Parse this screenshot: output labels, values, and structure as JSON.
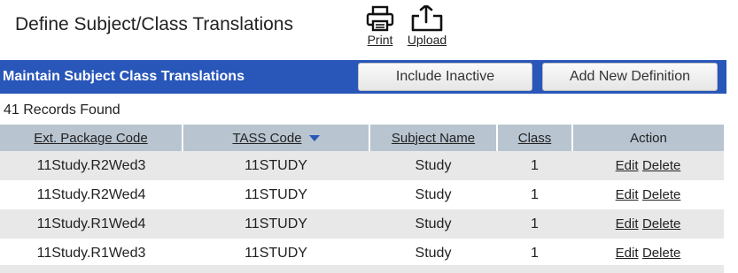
{
  "header": {
    "title": "Define Subject/Class Translations",
    "print_label": "Print",
    "upload_label": "Upload"
  },
  "banner": {
    "title": "Maintain Subject Class Translations",
    "include_inactive_label": "Include Inactive",
    "add_new_label": "Add New Definition",
    "color": "#2856b9"
  },
  "records_found": "41 Records Found",
  "table": {
    "columns": [
      "Ext. Package Code",
      "TASS Code",
      "Subject Name",
      "Class",
      "Action"
    ],
    "sorted_column": "TASS Code",
    "rows": [
      {
        "ext_code": "11Study.R2Wed3",
        "tass_code": "11STUDY",
        "subject": "Study",
        "class": "1",
        "edit": "Edit",
        "delete": "Delete"
      },
      {
        "ext_code": "11Study.R2Wed4",
        "tass_code": "11STUDY",
        "subject": "Study",
        "class": "1",
        "edit": "Edit",
        "delete": "Delete"
      },
      {
        "ext_code": "11Study.R1Wed4",
        "tass_code": "11STUDY",
        "subject": "Study",
        "class": "1",
        "edit": "Edit",
        "delete": "Delete"
      },
      {
        "ext_code": "11Study.R1Wed3",
        "tass_code": "11STUDY",
        "subject": "Study",
        "class": "1",
        "edit": "Edit",
        "delete": "Delete"
      }
    ]
  },
  "icons": {
    "print": "printer-icon",
    "upload": "upload-icon",
    "sort": "sort-desc-icon"
  }
}
